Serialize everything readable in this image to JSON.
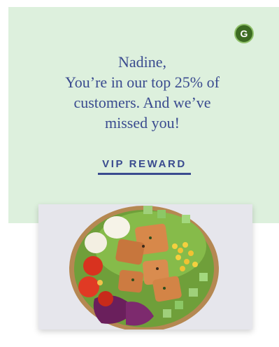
{
  "brand": {
    "logo_letter": "G",
    "logo_color": "#3c6b22"
  },
  "hero": {
    "background_color": "#ddf0dd",
    "text_color": "#3a4b8f",
    "message_lines": [
      "Nadine,",
      "You’re in our top 25% of",
      "customers. And we’ve",
      "missed you!"
    ],
    "cta_label": "VIP REWARD"
  },
  "image": {
    "subject": "salad bowl with grilled salmon, egg, corn, cucumber, tomato, red cabbage and greens"
  }
}
